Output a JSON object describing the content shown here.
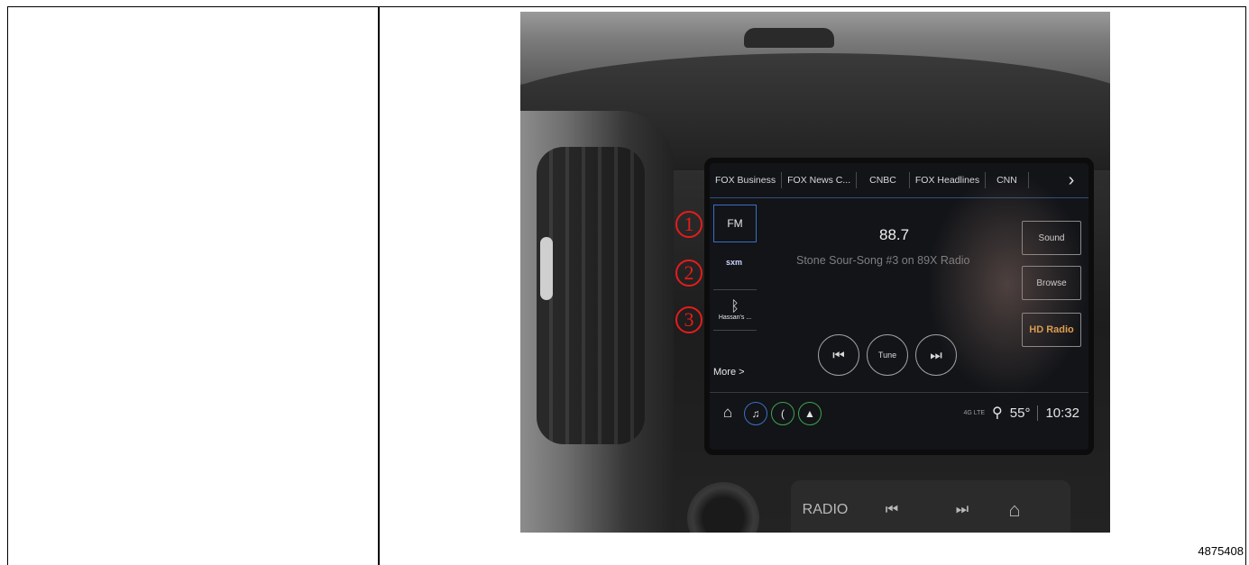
{
  "figure": {
    "id": "4875408"
  },
  "radio": {
    "tabs": [
      "FOX Business",
      "FOX News C...",
      "CNBC",
      "FOX Headlines",
      "CNN"
    ],
    "sources": {
      "fm": "FM",
      "sxm": "sxm",
      "bt_device": "Hassan's ...",
      "more": "More >"
    },
    "frequency": "88.7",
    "now_playing": "Stone Sour-Song #3 on 89X Radio",
    "side_buttons": {
      "sound": "Sound",
      "browse": "Browse",
      "hd": "HD Radio"
    },
    "controls": {
      "tune": "Tune"
    },
    "status": {
      "network": "4G LTE",
      "temperature": "55°",
      "time": "10:32"
    }
  },
  "physical_buttons": {
    "radio": "RADIO"
  },
  "annotations": [
    "1",
    "2",
    "3"
  ],
  "icons": [
    "chevron-right-icon",
    "bluetooth-icon",
    "previous-track-icon",
    "next-track-icon",
    "home-icon",
    "music-icon",
    "phone-icon",
    "navigation-icon",
    "location-icon"
  ],
  "colors": {
    "annotation": "#e51c1c",
    "accent": "#3b6fc4",
    "hd_radio": "#e8a34a"
  }
}
